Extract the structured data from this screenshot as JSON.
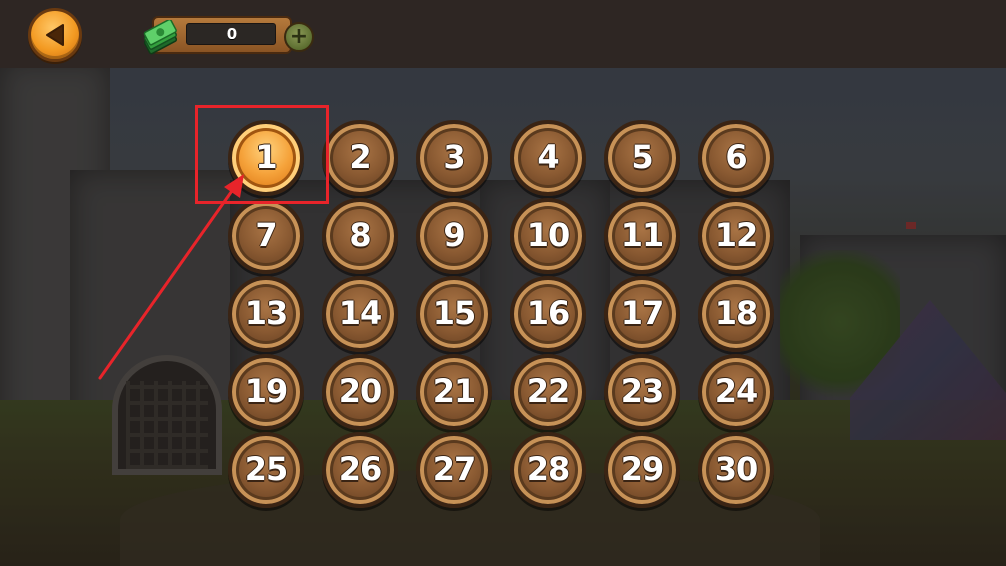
{
  "top_bar": {
    "back_icon": "back-arrow-icon",
    "cash_icon": "cash-stack-icon",
    "cash_value": "0",
    "add_cash_icon": "plus-icon"
  },
  "levels": [
    "1",
    "2",
    "3",
    "4",
    "5",
    "6",
    "7",
    "8",
    "9",
    "10",
    "11",
    "12",
    "13",
    "14",
    "15",
    "16",
    "17",
    "18",
    "19",
    "20",
    "21",
    "22",
    "23",
    "24",
    "25",
    "26",
    "27",
    "28",
    "29",
    "30"
  ],
  "selected_level": "1",
  "colors": {
    "accent_orange": "#f39a22",
    "level_brown": "#8a5a32",
    "annotation_red": "#e8242a",
    "top_bar": "#2e2623"
  }
}
